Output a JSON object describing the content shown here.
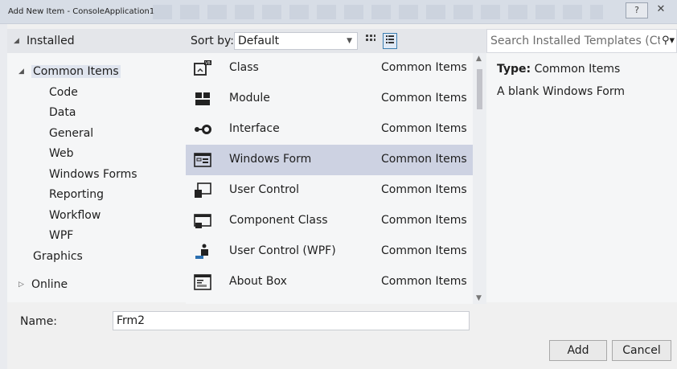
{
  "window": {
    "title": "Add New Item - ConsoleApplication1",
    "help_label": "?",
    "close_label": "✕"
  },
  "left": {
    "header": "Installed",
    "tree": [
      {
        "label": "Common Items",
        "expander": "◢"
      },
      {
        "label": "Code"
      },
      {
        "label": "Data"
      },
      {
        "label": "General"
      },
      {
        "label": "Web"
      },
      {
        "label": "Windows Forms"
      },
      {
        "label": "Reporting"
      },
      {
        "label": "Workflow"
      },
      {
        "label": "WPF"
      },
      {
        "label": "Graphics"
      },
      {
        "label": "Online",
        "expander": "▷"
      }
    ]
  },
  "middle": {
    "sort_label": "Sort by:",
    "sort_value": "Default",
    "items": [
      {
        "name": "Class",
        "category": "Common Items",
        "icon": "vb-class-icon"
      },
      {
        "name": "Module",
        "category": "Common Items",
        "icon": "module-icon"
      },
      {
        "name": "Interface",
        "category": "Common Items",
        "icon": "interface-icon"
      },
      {
        "name": "Windows Form",
        "category": "Common Items",
        "icon": "windows-form-icon"
      },
      {
        "name": "User Control",
        "category": "Common Items",
        "icon": "user-control-icon"
      },
      {
        "name": "Component Class",
        "category": "Common Items",
        "icon": "component-class-icon"
      },
      {
        "name": "User Control (WPF)",
        "category": "Common Items",
        "icon": "wpf-user-control-icon"
      },
      {
        "name": "About Box",
        "category": "Common Items",
        "icon": "about-box-icon"
      }
    ]
  },
  "right": {
    "search_placeholder": "Search Installed Templates (Ct",
    "type_label": "Type:",
    "type_value": "Common Items",
    "description": "A blank Windows Form"
  },
  "bottom": {
    "name_label": "Name:",
    "name_value": "Frm2",
    "add_label": "Add",
    "cancel_label": "Cancel"
  }
}
